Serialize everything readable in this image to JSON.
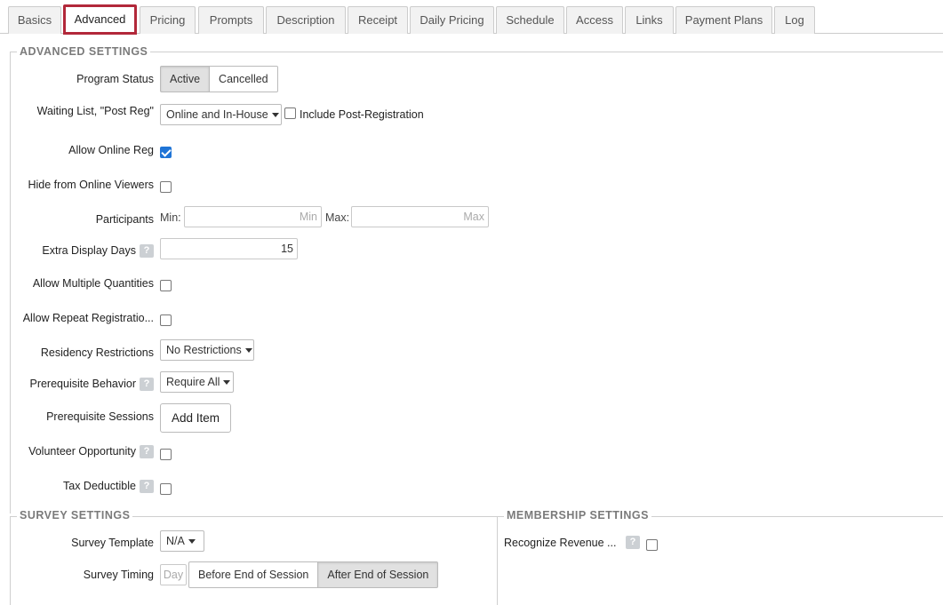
{
  "tabs": [
    {
      "label": "Basics"
    },
    {
      "label": "Advanced"
    },
    {
      "label": "Pricing"
    },
    {
      "label": "Prompts"
    },
    {
      "label": "Description"
    },
    {
      "label": "Receipt"
    },
    {
      "label": "Daily Pricing"
    },
    {
      "label": "Schedule"
    },
    {
      "label": "Access"
    },
    {
      "label": "Links"
    },
    {
      "label": "Payment Plans"
    },
    {
      "label": "Log"
    }
  ],
  "advanced": {
    "legend": "ADVANCED SETTINGS",
    "program_status": {
      "label": "Program Status",
      "options": [
        "Active",
        "Cancelled"
      ],
      "selected": "Active"
    },
    "waiting_list": {
      "label": "Waiting List, \"Post Reg\"",
      "value": "Online and In-House",
      "post_reg_label": "Include Post-Registration"
    },
    "allow_online_reg": {
      "label": "Allow Online Reg"
    },
    "hide_online": {
      "label": "Hide from Online Viewers"
    },
    "participants": {
      "label": "Participants",
      "min_label": "Min:",
      "min_placeholder": "Min",
      "max_label": "Max:",
      "max_placeholder": "Max"
    },
    "extra_display_days": {
      "label": "Extra Display Days",
      "value": "15",
      "help": "?"
    },
    "allow_multiple": {
      "label": "Allow Multiple Quantities"
    },
    "allow_repeat": {
      "label": "Allow Repeat Registratio..."
    },
    "residency": {
      "label": "Residency Restrictions",
      "value": "No Restrictions"
    },
    "prereq_behavior": {
      "label": "Prerequisite Behavior",
      "value": "Require All",
      "help": "?"
    },
    "prereq_sessions": {
      "label": "Prerequisite Sessions",
      "button": "Add Item"
    },
    "volunteer": {
      "label": "Volunteer Opportunity",
      "help": "?"
    },
    "tax_deductible": {
      "label": "Tax Deductible",
      "help": "?"
    }
  },
  "survey": {
    "legend": "SURVEY SETTINGS",
    "template": {
      "label": "Survey Template",
      "value": "N/A"
    },
    "timing": {
      "label": "Survey Timing",
      "day_placeholder": "Day",
      "options": [
        "Before End of Session",
        "After End of Session"
      ],
      "selected": "After End of Session"
    }
  },
  "membership": {
    "legend": "MEMBERSHIP SETTINGS",
    "recognize_revenue": {
      "label": "Recognize Revenue ...",
      "help": "?"
    }
  }
}
